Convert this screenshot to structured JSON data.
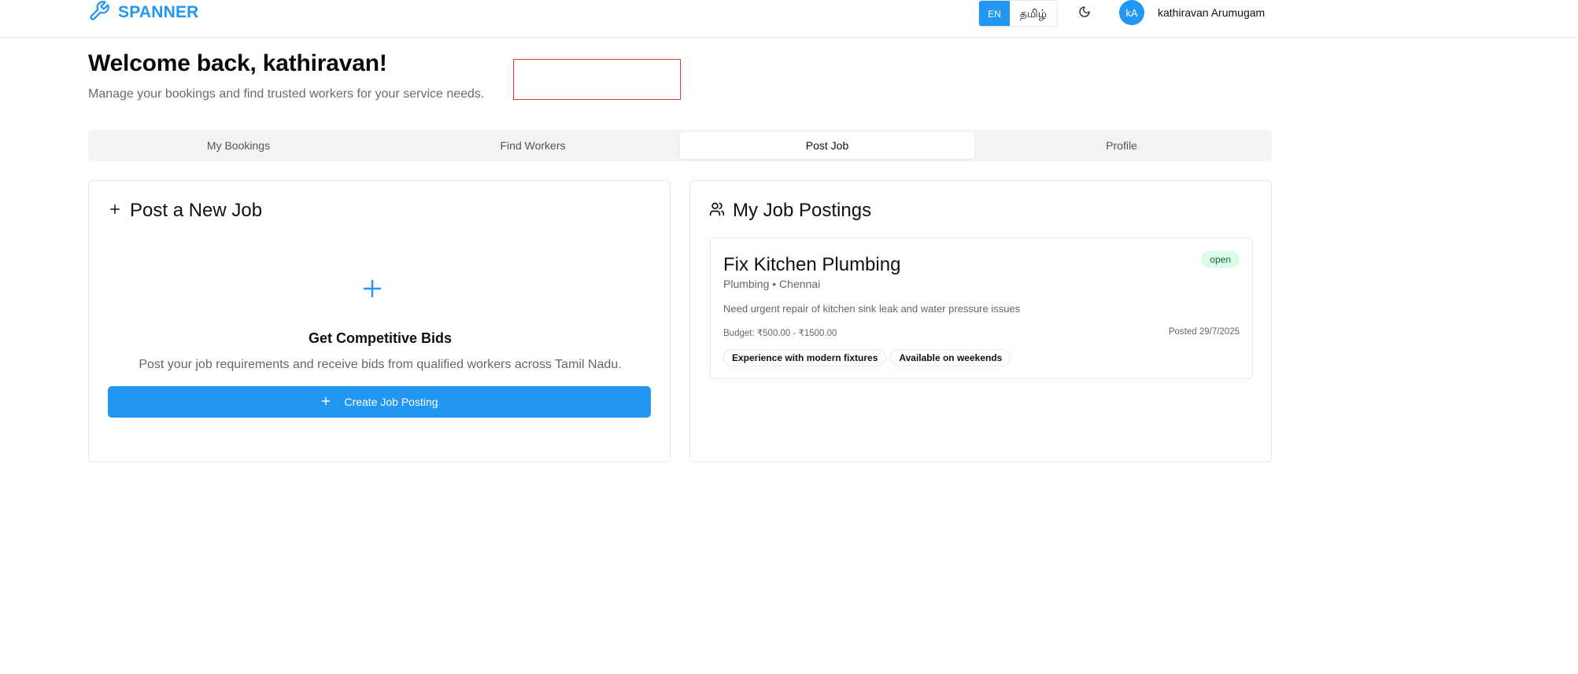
{
  "header": {
    "brand": "SPANNER",
    "lang_en": "EN",
    "lang_ta": "தமிழ்",
    "avatar_initials": "kA",
    "user_name": "kathiravan Arumugam"
  },
  "welcome": {
    "title": "Welcome back, kathiravan!",
    "subtitle": "Manage your bookings and find trusted workers for your service needs."
  },
  "tabs": [
    {
      "label": "My Bookings",
      "active": false
    },
    {
      "label": "Find Workers",
      "active": false
    },
    {
      "label": "Post Job",
      "active": true
    },
    {
      "label": "Profile",
      "active": false
    }
  ],
  "post_job": {
    "title": "Post a New Job",
    "bids_title": "Get Competitive Bids",
    "bids_desc": "Post your job requirements and receive bids from qualified workers across Tamil Nadu.",
    "button_label": "Create Job Posting"
  },
  "my_postings": {
    "title": "My Job Postings",
    "jobs": [
      {
        "title": "Fix Kitchen Plumbing",
        "meta": "Plumbing • Chennai",
        "status": "open",
        "description": "Need urgent repair of kitchen sink leak and water pressure issues",
        "budget": "Budget: ₹500.00 - ₹1500.00",
        "posted": "Posted 29/7/2025",
        "tags": [
          "Experience with modern fixtures",
          "Available on weekends"
        ]
      }
    ]
  },
  "colors": {
    "accent": "#2196f3",
    "status_open_bg": "#dcfce7",
    "status_open_text": "#166534",
    "highlight_box_border": "#e53935"
  },
  "icons": {
    "brand": "wrench-icon",
    "theme": "moon-icon",
    "post_job": "plus-icon",
    "postings": "users-icon"
  }
}
